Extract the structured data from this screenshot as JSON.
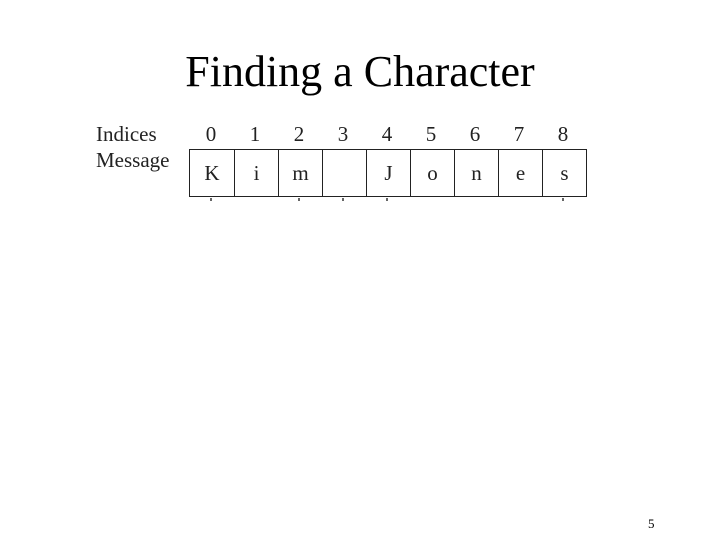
{
  "slide": {
    "title": "Finding a Character",
    "page_number": "5"
  },
  "figure": {
    "indices_label": "Indices",
    "message_label": "Message",
    "indices": [
      "0",
      "1",
      "2",
      "3",
      "4",
      "5",
      "6",
      "7",
      "8"
    ],
    "characters": [
      "K",
      "i",
      "m",
      " ",
      "J",
      "o",
      "n",
      "e",
      "s"
    ]
  }
}
